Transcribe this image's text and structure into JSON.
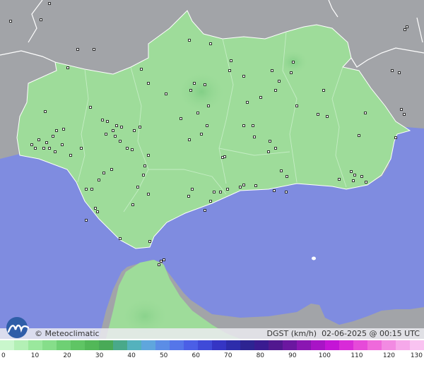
{
  "brand": "Meteoclimatic",
  "credit_text": "© Meteoclimatic",
  "variable_label": "DGST (km/h)",
  "timestamp": "02-06-2025 @ 00:15 UTC",
  "colors": {
    "sea": "#7f8ce0",
    "land_region": "#9edc9a",
    "land_other": "#a2a4a8",
    "border": "#ffffff",
    "station": "#222222"
  },
  "legend": {
    "ticks": [
      "0",
      "10",
      "20",
      "30",
      "40",
      "50",
      "60",
      "70",
      "80",
      "90",
      "100",
      "110",
      "120",
      "130"
    ],
    "colors": [
      "#c9f7cc",
      "#b3f0b5",
      "#9ae89d",
      "#86de8a",
      "#6ed074",
      "#5fc564",
      "#52b858",
      "#49aa57",
      "#49a98a",
      "#54b2bd",
      "#5fa6dd",
      "#5b8de6",
      "#5576e9",
      "#4b5fe6",
      "#3f4ad8",
      "#3535c4",
      "#2d2cab",
      "#2d2492",
      "#3a1b91",
      "#51188f",
      "#6b17a0",
      "#8a16b2",
      "#a814c6",
      "#c415d6",
      "#d82bd8",
      "#e64ad9",
      "#ef69db",
      "#f28ae2",
      "#f6a8ea",
      "#f9c3f1"
    ]
  }
}
